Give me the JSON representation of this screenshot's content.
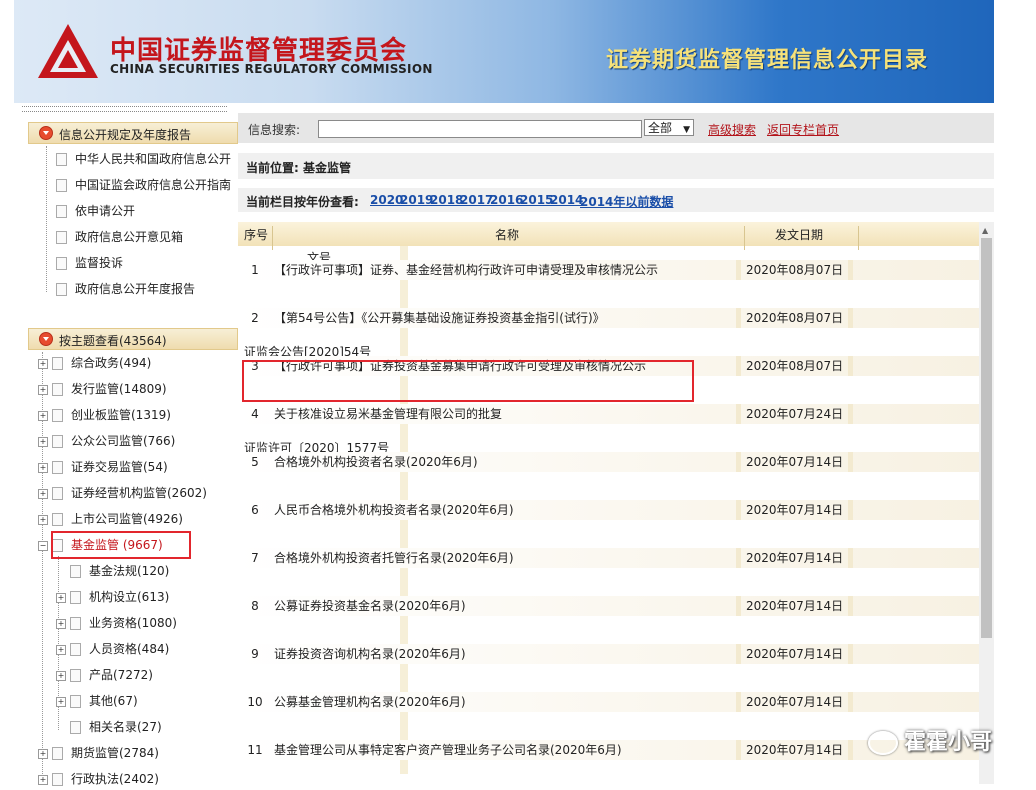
{
  "header": {
    "org_zh": "中国证券监督管理委员会",
    "org_en": "CHINA SECURITIES REGULATORY COMMISSION",
    "catalog_title": "证券期货监督管理信息公开目录"
  },
  "sidebar": {
    "rules_section": {
      "title": "信息公开规定及年度报告",
      "items": [
        "中华人民共和国政府信息公开",
        "中国证监会政府信息公开指南",
        "依申请公开",
        "政府信息公开意见箱",
        "监督投诉",
        "政府信息公开年度报告"
      ]
    },
    "topic_section": {
      "title": "按主题查看(43564)",
      "items": [
        {
          "label": "综合政务(494)"
        },
        {
          "label": "发行监管(14809)"
        },
        {
          "label": "创业板监管(1319)"
        },
        {
          "label": "公众公司监管(766)"
        },
        {
          "label": "证券交易监管(54)"
        },
        {
          "label": "证券经营机构监管(2602)"
        },
        {
          "label": "上市公司监管(4926)"
        },
        {
          "label": "基金监管 (9667)"
        },
        {
          "label": "基金法规(120)"
        },
        {
          "label": "机构设立(613)"
        },
        {
          "label": "业务资格(1080)"
        },
        {
          "label": "人员资格(484)"
        },
        {
          "label": "产品(7272)"
        },
        {
          "label": "其他(67)"
        },
        {
          "label": "相关名录(27)"
        },
        {
          "label": "期货监管(2784)"
        },
        {
          "label": "行政执法(2402)"
        }
      ]
    }
  },
  "search": {
    "label": "信息搜索:",
    "value": "",
    "scope": "全部",
    "advanced": "高级搜索",
    "home": "返回专栏首页"
  },
  "location": {
    "text": "当前位置: 基金监管"
  },
  "years": {
    "label": "当前栏目按年份查看:",
    "items": [
      "2020",
      "2019",
      "2018",
      "2017",
      "2016",
      "2015",
      "2014",
      "2014年以前数据"
    ]
  },
  "table": {
    "headers": [
      "序号",
      "名称",
      "发文日期",
      "文号"
    ],
    "rows": [
      {
        "no": "1",
        "title": "【行政许可事项】证券、基金经营机构行政许可申请受理及审核情况公示",
        "date": "2020年08月07日",
        "doc_no": ""
      },
      {
        "no": "2",
        "title": "【第54号公告】《公开募集基础设施证券投资基金指引(试行)》",
        "date": "2020年08月07日",
        "doc_no": "证监会公告[2020]54号"
      },
      {
        "no": "3",
        "title": "【行政许可事项】证券投资基金募集申请行政许可受理及审核情况公示",
        "date": "2020年08月07日",
        "doc_no": ""
      },
      {
        "no": "4",
        "title": "关于核准设立易米基金管理有限公司的批复",
        "date": "2020年07月24日",
        "doc_no": "证监许可〔2020〕1577号"
      },
      {
        "no": "5",
        "title": "合格境外机构投资者名录(2020年6月)",
        "date": "2020年07月14日",
        "doc_no": ""
      },
      {
        "no": "6",
        "title": "人民币合格境外机构投资者名录(2020年6月)",
        "date": "2020年07月14日",
        "doc_no": ""
      },
      {
        "no": "7",
        "title": "合格境外机构投资者托管行名录(2020年6月)",
        "date": "2020年07月14日",
        "doc_no": ""
      },
      {
        "no": "8",
        "title": "公募证券投资基金名录(2020年6月)",
        "date": "2020年07月14日",
        "doc_no": ""
      },
      {
        "no": "9",
        "title": "证券投资咨询机构名录(2020年6月)",
        "date": "2020年07月14日",
        "doc_no": ""
      },
      {
        "no": "10",
        "title": "公募基金管理机构名录(2020年6月)",
        "date": "2020年07月14日",
        "doc_no": ""
      },
      {
        "no": "11",
        "title": "基金管理公司从事特定客户资产管理业务子公司名录(2020年6月)",
        "date": "2020年07月14日",
        "doc_no": ""
      }
    ]
  },
  "watermark": {
    "text": "霍霍小哥"
  },
  "colors": {
    "brand_red": "#c4161c",
    "highlight_box": "#e2262d",
    "link_blue": "#1a4ea8",
    "header_blue": "#1f66bb"
  }
}
